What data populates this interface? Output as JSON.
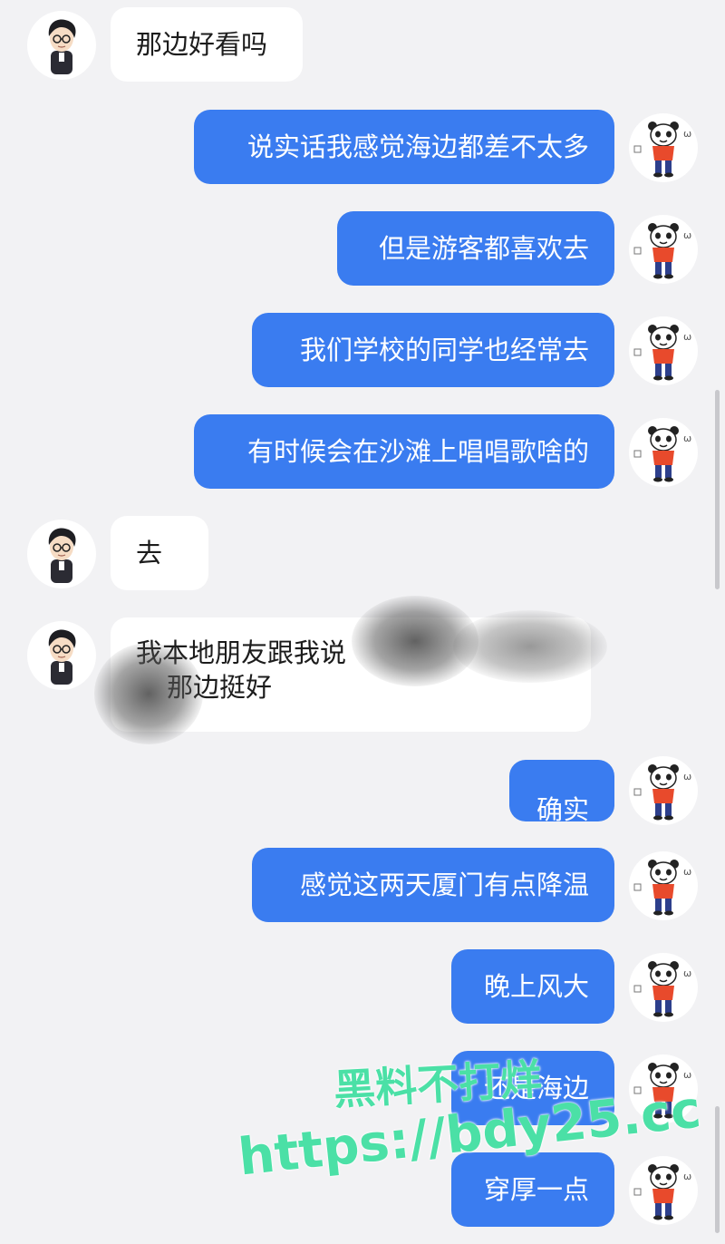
{
  "messages": [
    {
      "side": "in",
      "text": "那边好看吗"
    },
    {
      "side": "out",
      "text": "说实话我感觉海边都差不太多"
    },
    {
      "side": "out",
      "text": "但是游客都喜欢去"
    },
    {
      "side": "out",
      "text": "我们学校的同学也经常去"
    },
    {
      "side": "out",
      "text": "有时候会在沙滩上唱唱歌啥的"
    },
    {
      "side": "in",
      "text": "去"
    },
    {
      "side": "in",
      "line1": "我本地朋友跟我说",
      "line2": "那边挺好"
    },
    {
      "side": "out",
      "text": "确实"
    },
    {
      "side": "out",
      "text": "感觉这两天厦门有点降温"
    },
    {
      "side": "out",
      "text": "晚上风大"
    },
    {
      "side": "out",
      "text": "还是海边"
    },
    {
      "side": "out",
      "text": "穿厚一点"
    }
  ],
  "watermark": {
    "line1": "黑料不打烊",
    "line2": "https://bdy25.cc",
    "color": "#4be0a6"
  },
  "colors": {
    "background": "#f2f2f4",
    "outgoing_bubble": "#3a7cf0",
    "incoming_bubble": "#ffffff"
  },
  "avatars": {
    "contact": "cartoon-boy-glasses-avatar",
    "self": "cartoon-panda-red-shirt-avatar"
  }
}
